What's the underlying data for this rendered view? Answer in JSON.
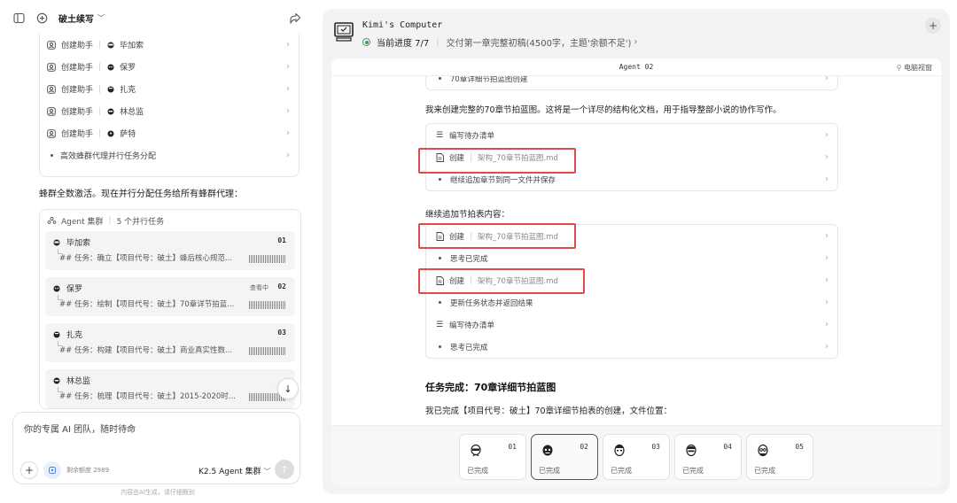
{
  "left": {
    "project": "破土续写",
    "steps": [
      {
        "action": "创建助手",
        "agent": "毕加索"
      },
      {
        "action": "创建助手",
        "agent": "保罗"
      },
      {
        "action": "创建助手",
        "agent": "扎克"
      },
      {
        "action": "创建助手",
        "agent": "林总监"
      },
      {
        "action": "创建助手",
        "agent": "萨特"
      },
      {
        "action": "高效蜂群代理并行任务分配"
      }
    ],
    "message": "蜂群全数激活。现在并行分配任务给所有蜂群代理：",
    "swarm": {
      "title": "Agent 集群",
      "count": "5 个并行任务",
      "agents": [
        {
          "name": "毕加索",
          "num": "01",
          "status": "",
          "task": "## 任务：确立【项目代号：破土】蜂后核心规范..."
        },
        {
          "name": "保罗",
          "num": "02",
          "status": "查看中",
          "task": "## 任务：绘制【项目代号：破土】70章详节拍蓝..."
        },
        {
          "name": "扎克",
          "num": "03",
          "status": "",
          "task": "## 任务：构建【项目代号：破土】商业真实性数..."
        },
        {
          "name": "林总监",
          "num": "",
          "status": "",
          "task": "## 任务：梳理【项目代号：破土】2015-2020时..."
        }
      ]
    },
    "input": {
      "placeholder": "你的专属 AI 团队，随时待命",
      "quota": "剩余额度 2989",
      "model": "K2.5 Agent 集群"
    },
    "footnote": "内容由AI生成，请仔细甄别"
  },
  "right": {
    "title": "Kimi's Computer",
    "progress": "当前进度 7/7",
    "progress_desc": "交付第一章完整初稿(4500字，主题'余额不足')",
    "agent": "Agent 02",
    "view": "电脑视窗",
    "top_item": "70章详细节拍蓝图创建",
    "p1": "我来创建完整的70章节拍蓝图。这将是一个详尽的结构化文档，用于指导整部小说的协作写作。",
    "box1": [
      {
        "type": "todo",
        "label": "编写待办清单"
      },
      {
        "type": "create",
        "label": "创建",
        "file": "架构_70章节拍蓝图.md"
      },
      {
        "type": "bullet",
        "label": "继续追加章节到同一文件并保存"
      }
    ],
    "p2": "继续追加节拍表内容：",
    "box2": [
      {
        "type": "create",
        "label": "创建",
        "file": "架构_70章节拍蓝图.md"
      },
      {
        "type": "bullet",
        "label": "思考已完成"
      },
      {
        "type": "create",
        "label": "创建",
        "file": "架构_70章节拍蓝图.md"
      },
      {
        "type": "bullet",
        "label": "更新任务状态并返回结果"
      },
      {
        "type": "todo",
        "label": "编写待办清单"
      },
      {
        "type": "bullet",
        "label": "思考已完成"
      }
    ],
    "done_title": "任务完成：70章详细节拍蓝图",
    "p3": "我已完成【项目代号：破土】70章详细节拍表的创建，文件位置：",
    "agents": [
      {
        "num": "01",
        "status": "已完成"
      },
      {
        "num": "02",
        "status": "已完成"
      },
      {
        "num": "03",
        "status": "已完成"
      },
      {
        "num": "04",
        "status": "已完成"
      },
      {
        "num": "05",
        "status": "已完成"
      }
    ]
  },
  "colors": {
    "accent_green": "#3aa05a",
    "highlight_red": "#e04a4a"
  }
}
